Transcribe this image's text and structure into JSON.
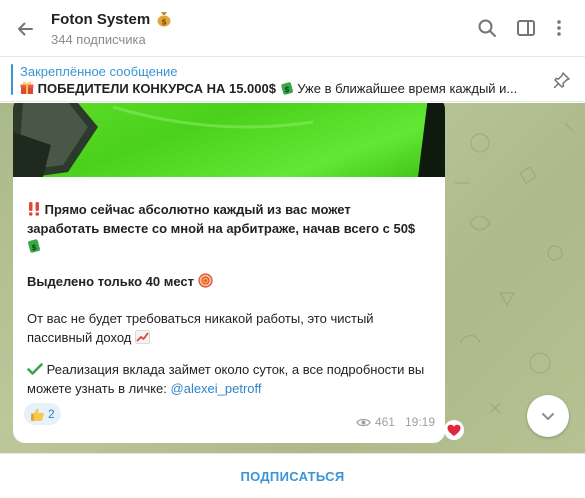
{
  "header": {
    "title": "Foton System",
    "subtitle": "344 подписчика"
  },
  "pinned": {
    "title": "Закреплённое сообщение",
    "bold_text": "ПОБЕДИТЕЛИ КОНКУРСА НА 15.000$",
    "text": "Уже в ближайшее время каждый и..."
  },
  "message": {
    "line1": "Прямо сейчас абсолютно каждый из вас может",
    "line2": "заработать вместе со мной на арбитраже, начав всего с 50$",
    "line3": "Выделено только 40 мест",
    "line4": "От вас не будет требоваться никакой работы, это чистый",
    "line5": "пассивный доход",
    "line6": "Реализация вклада займет около суток, а все подробности вы",
    "line7_prefix": "можете узнать в личке: ",
    "line7_link": "@alexei_petroff",
    "reaction_count": "2",
    "views": "461",
    "time": "19:19"
  },
  "footer": {
    "subscribe_label": "ПОДПИСАТЬСЯ"
  },
  "colors": {
    "accent": "#3a95d5",
    "link": "#2f83c7",
    "background_pattern": "#b5c192"
  }
}
